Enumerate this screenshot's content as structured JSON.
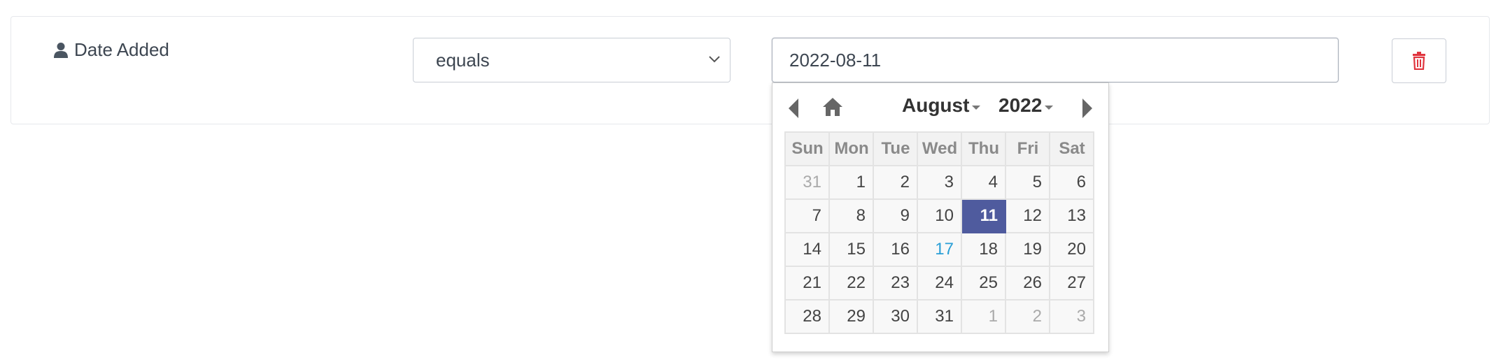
{
  "filter": {
    "field_label": "Date Added",
    "field_icon": "user-icon",
    "operator": {
      "selected": "equals"
    },
    "value": "2022-08-11",
    "delete_icon": "trash-icon",
    "colors": {
      "delete": "#e0353e",
      "border": "#c9ced6",
      "text": "#3d4651"
    }
  },
  "datepicker": {
    "month": "August",
    "year": "2022",
    "weekdays": [
      "Sun",
      "Mon",
      "Tue",
      "Wed",
      "Thu",
      "Fri",
      "Sat"
    ],
    "weeks": [
      [
        {
          "d": "31",
          "cls": "other-month"
        },
        {
          "d": "1"
        },
        {
          "d": "2"
        },
        {
          "d": "3"
        },
        {
          "d": "4"
        },
        {
          "d": "5"
        },
        {
          "d": "6"
        }
      ],
      [
        {
          "d": "7"
        },
        {
          "d": "8"
        },
        {
          "d": "9"
        },
        {
          "d": "10"
        },
        {
          "d": "11",
          "cls": "selected"
        },
        {
          "d": "12"
        },
        {
          "d": "13"
        }
      ],
      [
        {
          "d": "14"
        },
        {
          "d": "15"
        },
        {
          "d": "16"
        },
        {
          "d": "17",
          "cls": "today"
        },
        {
          "d": "18"
        },
        {
          "d": "19"
        },
        {
          "d": "20"
        }
      ],
      [
        {
          "d": "21"
        },
        {
          "d": "22"
        },
        {
          "d": "23"
        },
        {
          "d": "24"
        },
        {
          "d": "25"
        },
        {
          "d": "26"
        },
        {
          "d": "27"
        }
      ],
      [
        {
          "d": "28"
        },
        {
          "d": "29"
        },
        {
          "d": "30"
        },
        {
          "d": "31"
        },
        {
          "d": "1",
          "cls": "other-month"
        },
        {
          "d": "2",
          "cls": "other-month"
        },
        {
          "d": "3",
          "cls": "other-month"
        }
      ]
    ],
    "colors": {
      "selected_bg": "#4f5b9e",
      "today_text": "#2a9fd6"
    }
  }
}
